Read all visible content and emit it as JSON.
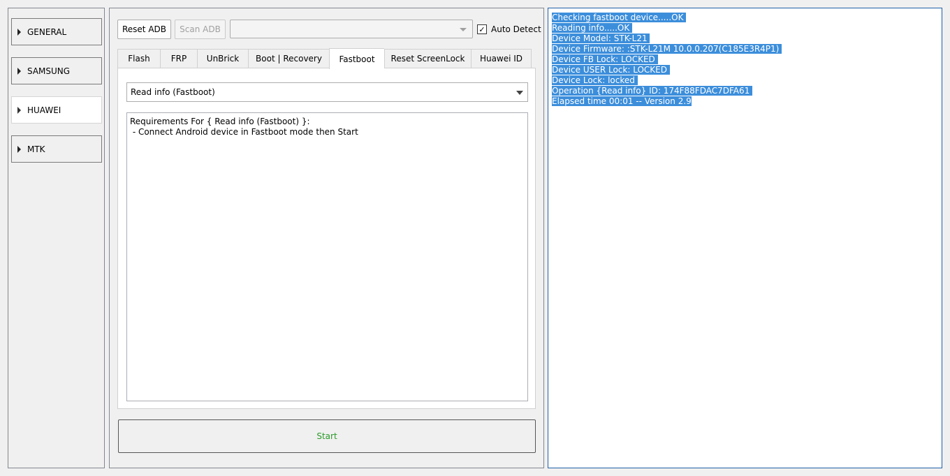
{
  "categories": [
    {
      "label": "GENERAL",
      "active": false
    },
    {
      "label": "SAMSUNG",
      "active": false
    },
    {
      "label": "HUAWEI",
      "active": true
    },
    {
      "label": "MTK",
      "active": false
    }
  ],
  "toolbar": {
    "reset_adb_label": "Reset ADB",
    "scan_adb_label": "Scan ADB",
    "device_combo_value": "",
    "auto_detect_label": "Auto Detect",
    "auto_detect_checked": true
  },
  "tabs": [
    {
      "label": "Flash"
    },
    {
      "label": "FRP"
    },
    {
      "label": "UnBrick"
    },
    {
      "label": "Boot | Recovery"
    },
    {
      "label": "Fastboot",
      "active": true
    },
    {
      "label": "Reset ScreenLock"
    },
    {
      "label": "Huawei ID"
    }
  ],
  "operation": {
    "selected": "Read info (Fastboot)"
  },
  "requirements": {
    "line1": "Requirements For { Read info (Fastboot) }:",
    "line2": " - Connect Android device in Fastboot mode then Start"
  },
  "start_label": "Start",
  "log": [
    "Checking fastboot device.....OK ",
    "Reading info.....OK ",
    "Device Model: STK-L21 ",
    "Device Firmware: :STK-L21M 10.0.0.207(C185E3R4P1) ",
    "Device FB Lock: LOCKED ",
    "Device USER Lock: LOCKED ",
    "Device Lock: locked ",
    "Operation {Read info} ID: 174F88FDAC7DFA61 ",
    "Elapsed time 00:01 -- Version 2.9"
  ]
}
